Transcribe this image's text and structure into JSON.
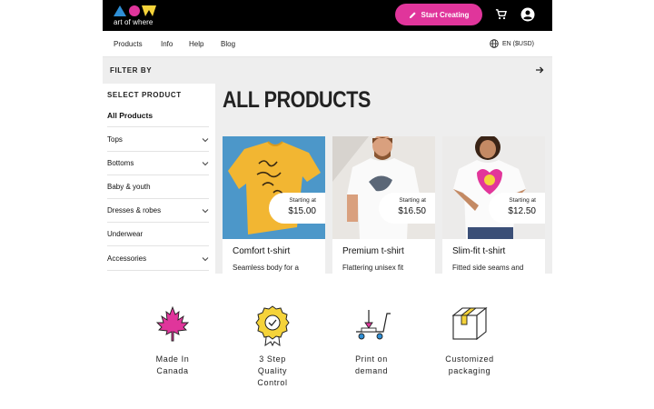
{
  "brand": {
    "logo_text": "art of where"
  },
  "header": {
    "cta_label": "Start Creating",
    "icons": [
      "pencil-icon",
      "cart-icon",
      "user-icon"
    ]
  },
  "nav": {
    "links": [
      "Products",
      "Info",
      "Help",
      "Blog"
    ],
    "language": "EN ($USD)"
  },
  "filter": {
    "label": "FILTER BY"
  },
  "sidebar": {
    "title": "SELECT PRODUCT",
    "items": [
      {
        "label": "All Products",
        "expandable": false,
        "active": true
      },
      {
        "label": "Tops",
        "expandable": true
      },
      {
        "label": "Bottoms",
        "expandable": true
      },
      {
        "label": "Baby & youth",
        "expandable": false
      },
      {
        "label": "Dresses & robes",
        "expandable": true
      },
      {
        "label": "Underwear",
        "expandable": false
      },
      {
        "label": "Accessories",
        "expandable": true
      }
    ]
  },
  "main": {
    "title": "ALL PRODUCTS",
    "products": [
      {
        "name": "Comfort t-shirt",
        "starting_label": "Starting at",
        "price": "$15.00",
        "description": "Seamless body for a"
      },
      {
        "name": "Premium t-shirt",
        "starting_label": "Starting at",
        "price": "$16.50",
        "description": "Flattering unisex fit"
      },
      {
        "name": "Slim-fit t-shirt",
        "starting_label": "Starting at",
        "price": "$12.50",
        "description": "Fitted side seams and"
      }
    ]
  },
  "features": [
    {
      "label": "Made In\nCanada",
      "icon": "maple-leaf-icon"
    },
    {
      "label": "3 Step\nQuality\nControl",
      "icon": "quality-badge-icon"
    },
    {
      "label": "Print on\ndemand",
      "icon": "print-cart-icon"
    },
    {
      "label": "Customized\npackaging",
      "icon": "package-icon"
    }
  ],
  "colors": {
    "accent": "#e0359b",
    "yellow": "#f5d33a",
    "blue": "#2f8fd6",
    "header_bg": "#000000"
  }
}
